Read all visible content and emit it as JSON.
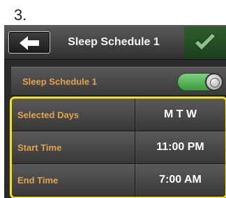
{
  "step_label": "3.",
  "header": {
    "title": "Sleep Schedule 1",
    "back_icon": "arrow-left-icon",
    "confirm_icon": "checkmark-icon"
  },
  "toggle_row": {
    "label": "Sleep Schedule 1",
    "enabled": true
  },
  "schedule_rows": [
    {
      "label": "Selected Days",
      "value": "M T W"
    },
    {
      "label": "Start Time",
      "value": "11:00 PM"
    },
    {
      "label": "End Time",
      "value": "7:00 AM"
    }
  ],
  "colors": {
    "label_orange": "#e3a24a",
    "highlight_yellow": "#f2e21a",
    "toggle_green": "#4caf50",
    "confirm_green": "#2f5d2f"
  }
}
